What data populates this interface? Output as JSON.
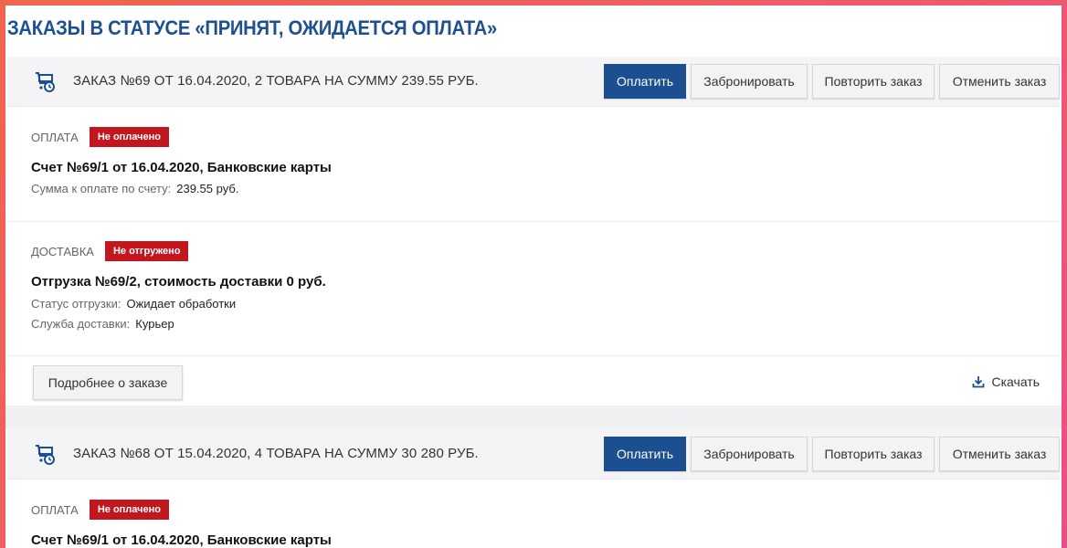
{
  "page": {
    "title": "ЗАКАЗЫ В СТАТУСЕ «ПРИНЯТ, ОЖИДАЕТСЯ ОПЛАТА»"
  },
  "colors": {
    "brand": "#1c4f90",
    "badge_red": "#c3171f",
    "title_blue": "#1e4f8f"
  },
  "orders": [
    {
      "icon": "cart-clock-icon",
      "title": "ЗАКАЗ №69 ОТ 16.04.2020, 2 ТОВАРА НА СУММУ 239.55 РУБ.",
      "buttons": {
        "pay": "Оплатить",
        "reserve": "Забронировать",
        "repeat": "Повторить заказ",
        "cancel": "Отменить заказ"
      },
      "payment": {
        "label": "ОПЛАТА",
        "badge": "Не оплачено",
        "heading": "Счет №69/1 от 16.04.2020, Банковские карты",
        "amount_label": "Сумма к оплате по счету:",
        "amount_value": "239.55 руб."
      },
      "delivery": {
        "label": "ДОСТАВКА",
        "badge": "Не отгружено",
        "heading": "Отгрузка №69/2, стоимость доставки 0 руб.",
        "status_label": "Статус отгрузки:",
        "status_value": "Ожидает обработки",
        "service_label": "Служба доставки:",
        "service_value": "Курьер"
      },
      "footer": {
        "details": "Подробнее о заказе",
        "download": "Скачать",
        "download_icon": "download-icon"
      }
    },
    {
      "icon": "cart-clock-icon",
      "title": "ЗАКАЗ №68 ОТ 15.04.2020, 4 ТОВАРА НА СУММУ 30 280 РУБ.",
      "buttons": {
        "pay": "Оплатить",
        "reserve": "Забронировать",
        "repeat": "Повторить заказ",
        "cancel": "Отменить заказ"
      },
      "payment": {
        "label": "ОПЛАТА",
        "badge": "Не оплачено",
        "heading": "Счет №69/1 от 16.04.2020, Банковские карты"
      }
    }
  ]
}
